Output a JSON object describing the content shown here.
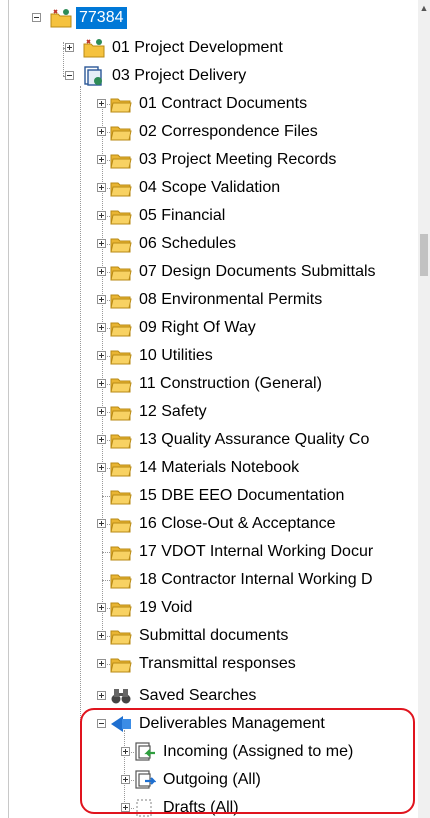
{
  "tree": {
    "root": {
      "label": "77384",
      "icon": "project-root-icon"
    },
    "project_development": {
      "label": "01 Project Development",
      "icon": "project-folder-icon"
    },
    "project_delivery": {
      "label": "03 Project Delivery",
      "icon": "document-set-icon",
      "children": [
        {
          "label": "01 Contract Documents",
          "expander": true
        },
        {
          "label": "02 Correspondence Files",
          "expander": true
        },
        {
          "label": "03 Project Meeting Records",
          "expander": true
        },
        {
          "label": "04 Scope Validation",
          "expander": true
        },
        {
          "label": "05 Financial",
          "expander": true
        },
        {
          "label": "06 Schedules",
          "expander": true
        },
        {
          "label": "07 Design Documents Submittals",
          "expander": true
        },
        {
          "label": "08 Environmental Permits",
          "expander": true
        },
        {
          "label": "09 Right Of Way",
          "expander": true
        },
        {
          "label": "10 Utilities",
          "expander": true
        },
        {
          "label": "11 Construction (General)",
          "expander": true
        },
        {
          "label": "12 Safety",
          "expander": true
        },
        {
          "label": "13 Quality Assurance  Quality Co",
          "expander": true
        },
        {
          "label": "14 Materials Notebook",
          "expander": true
        },
        {
          "label": "15 DBE EEO Documentation",
          "expander": false
        },
        {
          "label": "16 Close-Out & Acceptance",
          "expander": true
        },
        {
          "label": "17 VDOT Internal Working Docur",
          "expander": false
        },
        {
          "label": "18 Contractor Internal Working D",
          "expander": false
        },
        {
          "label": "19 Void",
          "expander": true
        },
        {
          "label": "Submittal documents",
          "expander": true
        },
        {
          "label": "Transmittal responses",
          "expander": true
        }
      ]
    },
    "saved_searches": {
      "label": "Saved Searches",
      "icon": "binoculars-icon"
    },
    "deliverables": {
      "label": "Deliverables Management",
      "icon": "deliverables-icon",
      "children": [
        {
          "label": "Incoming (Assigned to me)",
          "icon": "incoming-icon"
        },
        {
          "label": "Outgoing (All)",
          "icon": "outgoing-icon"
        },
        {
          "label": "Drafts (All)",
          "icon": "drafts-icon"
        }
      ]
    }
  },
  "colors": {
    "selection": "#0078d7",
    "highlight_border": "#e0141e",
    "folder": "#f5c23e"
  }
}
